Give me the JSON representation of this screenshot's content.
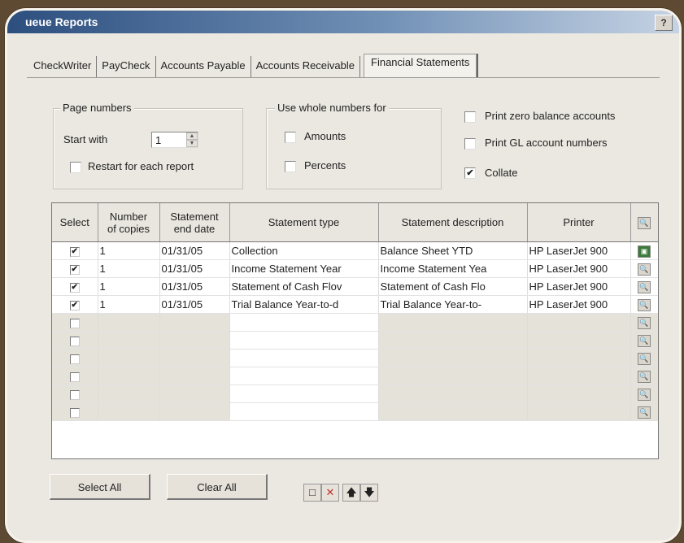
{
  "window": {
    "title": "ueue Reports",
    "help": "?"
  },
  "tabs": [
    "CheckWriter",
    "PayCheck",
    "Accounts Payable",
    "Accounts Receivable",
    "Financial Statements"
  ],
  "page_numbers": {
    "title": "Page numbers",
    "start_with_label": "Start with",
    "start_with_value": "1",
    "restart_label": "Restart for each report",
    "restart_checked": false
  },
  "whole_numbers": {
    "title": "Use whole numbers for",
    "amounts_label": "Amounts",
    "amounts_checked": false,
    "percents_label": "Percents",
    "percents_checked": false
  },
  "options": {
    "zero_balance_label": "Print zero balance accounts",
    "zero_balance_checked": false,
    "gl_numbers_label": "Print GL account numbers",
    "gl_numbers_checked": false,
    "collate_label": "Collate",
    "collate_checked": true
  },
  "grid": {
    "headers": {
      "select": "Select",
      "copies_1": "Number",
      "copies_2": "of copies",
      "end_1": "Statement",
      "end_2": "end date",
      "type": "Statement type",
      "description": "Statement description",
      "printer": "Printer"
    },
    "rows": [
      {
        "select": true,
        "copies": "1",
        "end_date": "01/31/05",
        "type": "Collection",
        "description": "Balance Sheet YTD",
        "printer": "HP LaserJet 900"
      },
      {
        "select": true,
        "copies": "1",
        "end_date": "01/31/05",
        "type": "Income Statement Year",
        "description": "Income Statement Yea",
        "printer": "HP LaserJet 900"
      },
      {
        "select": true,
        "copies": "1",
        "end_date": "01/31/05",
        "type": "Statement of Cash Flov",
        "description": "Statement of Cash Flo",
        "printer": "HP LaserJet 900"
      },
      {
        "select": true,
        "copies": "1",
        "end_date": "01/31/05",
        "type": "Trial Balance Year-to-d",
        "description": "Trial Balance Year-to-",
        "printer": "HP LaserJet 900"
      },
      {
        "select": false,
        "copies": "",
        "end_date": "",
        "type": "",
        "description": "",
        "printer": ""
      },
      {
        "select": false,
        "copies": "",
        "end_date": "",
        "type": "",
        "description": "",
        "printer": ""
      },
      {
        "select": false,
        "copies": "",
        "end_date": "",
        "type": "",
        "description": "",
        "printer": ""
      },
      {
        "select": false,
        "copies": "",
        "end_date": "",
        "type": "",
        "description": "",
        "printer": ""
      },
      {
        "select": false,
        "copies": "",
        "end_date": "",
        "type": "",
        "description": "",
        "printer": ""
      },
      {
        "select": false,
        "copies": "",
        "end_date": "",
        "type": "",
        "description": "",
        "printer": ""
      }
    ]
  },
  "buttons": {
    "select_all": "Select All",
    "clear_all": "Clear All"
  },
  "toolbar": {
    "new_icon": "new-row-icon",
    "delete_icon": "delete-icon",
    "up_icon": "move-up-icon",
    "down_icon": "move-down-icon"
  },
  "colors": {
    "titlebar": "#2d4f7f",
    "panel": "#ebe8e1",
    "frame_bg": "#5e4a33"
  }
}
